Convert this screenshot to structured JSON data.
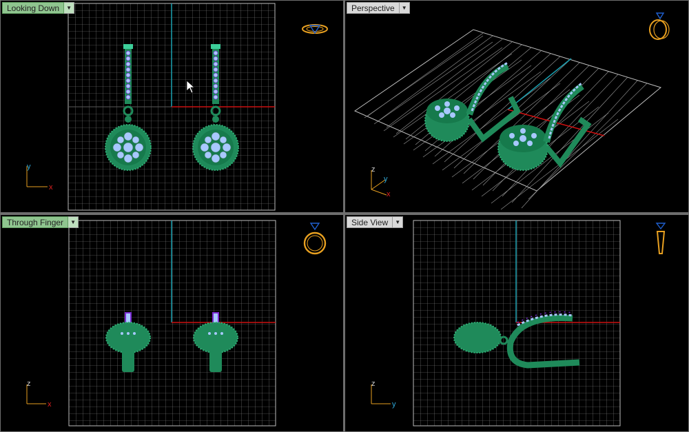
{
  "viewports": {
    "top_left": {
      "label": "Looking Down",
      "axes": [
        "y",
        "x"
      ]
    },
    "top_right": {
      "label": "Perspective",
      "axes": [
        "z",
        "y",
        "x"
      ]
    },
    "bottom_left": {
      "label": "Through Finger",
      "axes": [
        "z",
        "x"
      ]
    },
    "bottom_right": {
      "label": "Side View",
      "axes": [
        "z",
        "y"
      ]
    }
  },
  "dropdown_glyph": "▼",
  "colors": {
    "background": "#000000",
    "grid": "#9a9a9a",
    "axis_x": "#cc1010",
    "axis_y": "#1a9fb0",
    "metal": "#1f8a5a",
    "gem": "#a8c8ff",
    "prong": "#7a2ad0",
    "nav_icon": "#e8a020",
    "active_label": "#8fc58f"
  },
  "icons": {
    "top_left": "ring-top-icon",
    "top_right": "ring-perspective-icon",
    "bottom_left": "ring-front-icon",
    "bottom_right": "ring-side-icon"
  }
}
